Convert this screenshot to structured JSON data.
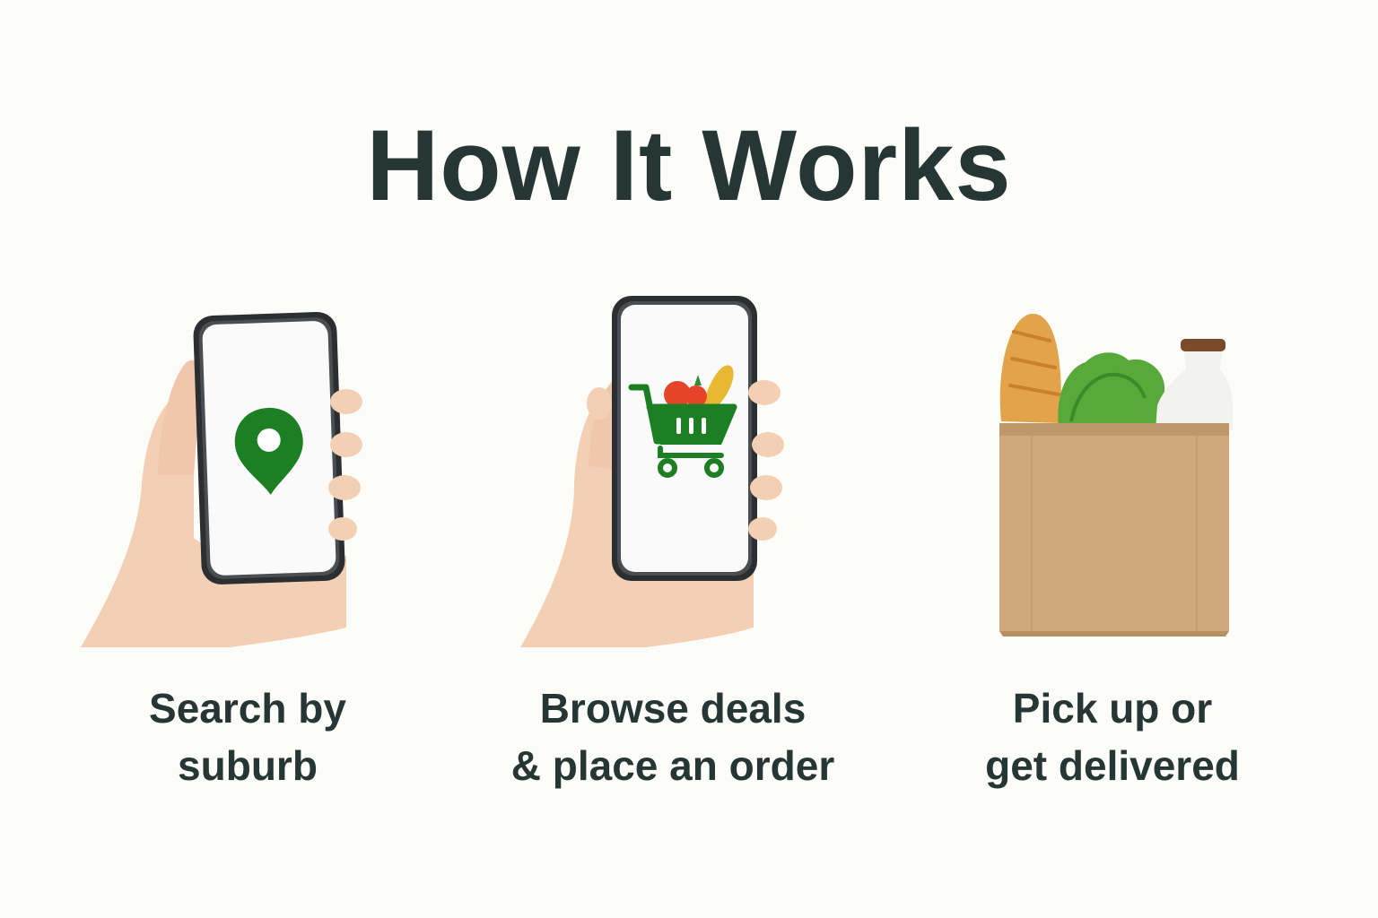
{
  "page": {
    "title": "How It Works"
  },
  "steps": [
    {
      "caption": "Search by\nsuburb",
      "icon": "location-pin-icon"
    },
    {
      "caption": "Browse deals\n& place an order",
      "icon": "shopping-cart-icon"
    },
    {
      "caption": "Pick up or\nget delivered",
      "icon": "grocery-bag-icon"
    }
  ],
  "colors": {
    "text": "#263635",
    "accent_green": "#1d7f24",
    "background": "#fcfcf9",
    "bag": "#cfa97b"
  }
}
